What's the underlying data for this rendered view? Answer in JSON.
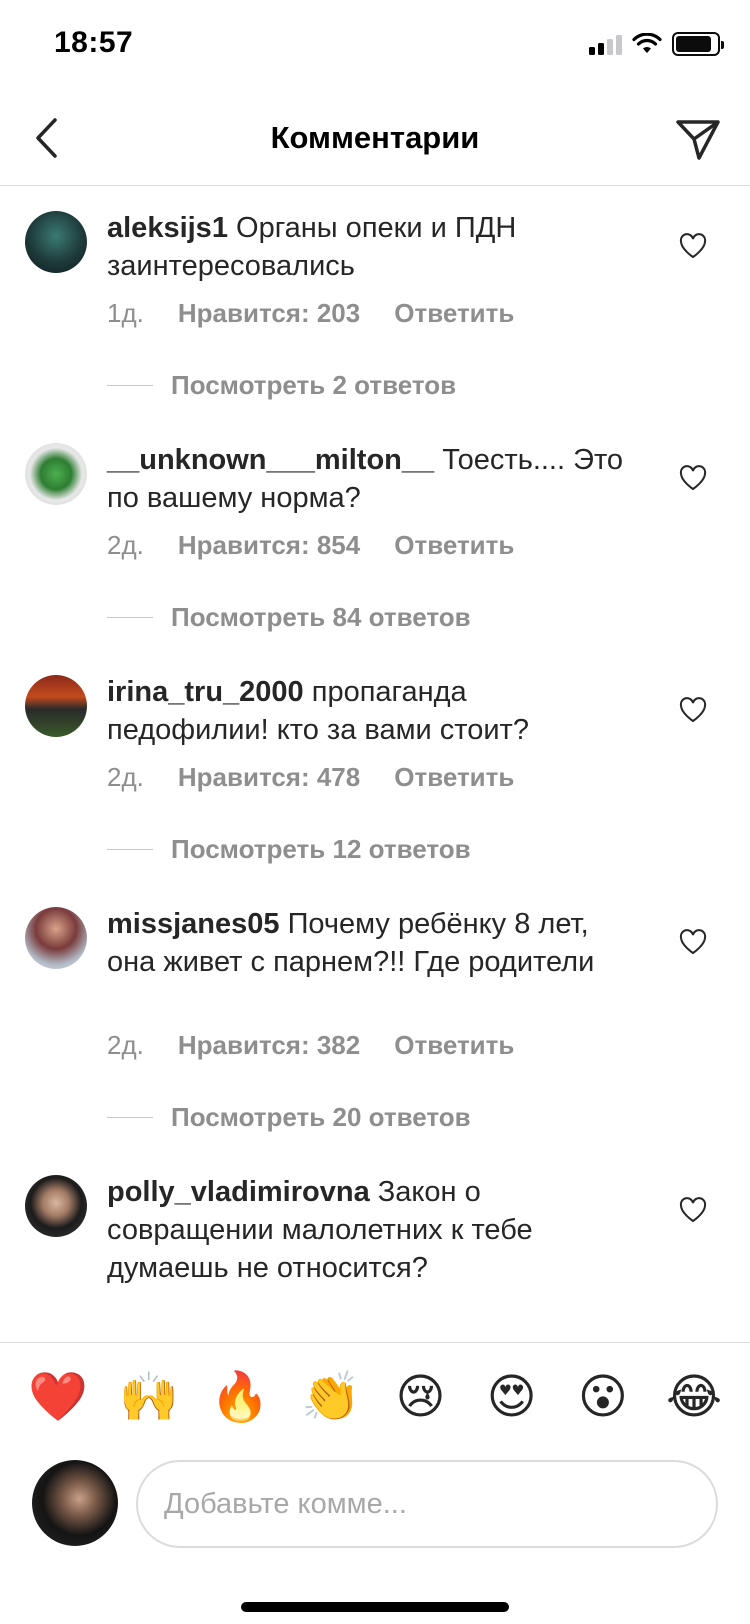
{
  "status": {
    "time": "18:57"
  },
  "header": {
    "title": "Комментарии"
  },
  "comments": [
    {
      "username": "aleksijs1",
      "text": "Органы опеки и ПДН заинтересовались",
      "time": "1д.",
      "likes": "Нравится: 203",
      "reply": "Ответить",
      "view_replies": "Посмотреть 2 ответов"
    },
    {
      "username": "__unknown___milton__",
      "text": "Тоесть.... Это по вашему норма?",
      "time": "2д.",
      "likes": "Нравится: 854",
      "reply": "Ответить",
      "view_replies": "Посмотреть 84 ответов"
    },
    {
      "username": "irina_tru_2000",
      "text": "пропаганда педофилии! кто за вами стоит?",
      "time": "2д.",
      "likes": "Нравится: 478",
      "reply": "Ответить",
      "view_replies": "Посмотреть 12 ответов"
    },
    {
      "username": "missjanes05",
      "text": "Почему ребёнку 8 лет, она живет с парнем?!! Где родители",
      "time": "2д.",
      "likes": "Нравится: 382",
      "reply": "Ответить",
      "view_replies": "Посмотреть 20 ответов"
    },
    {
      "username": "polly_vladimirovna",
      "text": "Закон о совращении малолетних к тебе думаешь не относится?"
    }
  ],
  "emoji_bar": [
    "❤️",
    "🙌",
    "🔥",
    "👏",
    "😢",
    "😍",
    "😮",
    "😂"
  ],
  "input": {
    "placeholder": "Добавьте комме..."
  },
  "colors": {
    "text": "#262626",
    "meta": "#8e8e8e",
    "divider": "#dbdbdb"
  }
}
